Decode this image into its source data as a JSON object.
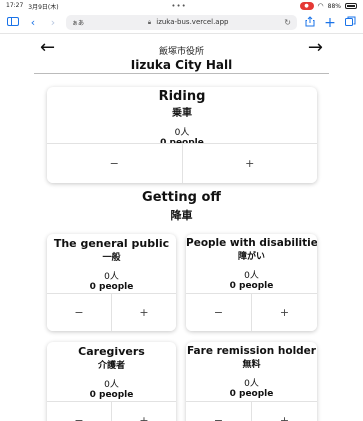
{
  "status_bar": {
    "time": "17:27",
    "date": "3月9日(木)",
    "center_dots": "•••",
    "battery": "88%"
  },
  "browser": {
    "aa": "ぁあ",
    "url": "izuka-bus.vercel.app"
  },
  "stop": {
    "name_jp": "飯塚市役所",
    "name_en": "Iizuka City Hall",
    "prev_arrow": "←",
    "next_arrow": "→"
  },
  "riding": {
    "title": "Riding",
    "title_jp": "乗車",
    "count": "0人",
    "people": "0 people",
    "minus": "−",
    "plus": "+"
  },
  "getting_off": {
    "title": "Getting off",
    "title_jp": "降車"
  },
  "categories": [
    {
      "title": "The general public",
      "title_jp": "一般",
      "count": "0人",
      "people": "0 people",
      "minus": "−",
      "plus": "+"
    },
    {
      "title": "People with disabilities",
      "title_jp": "障がい",
      "count": "0人",
      "people": "0 people",
      "minus": "−",
      "plus": "+"
    },
    {
      "title": "Caregivers",
      "title_jp": "介護者",
      "count": "0人",
      "people": "0 people",
      "minus": "−",
      "plus": "+"
    },
    {
      "title": "Fare remission holder",
      "title_jp": "無料",
      "count": "0人",
      "people": "0 people",
      "minus": "−",
      "plus": "+"
    }
  ]
}
